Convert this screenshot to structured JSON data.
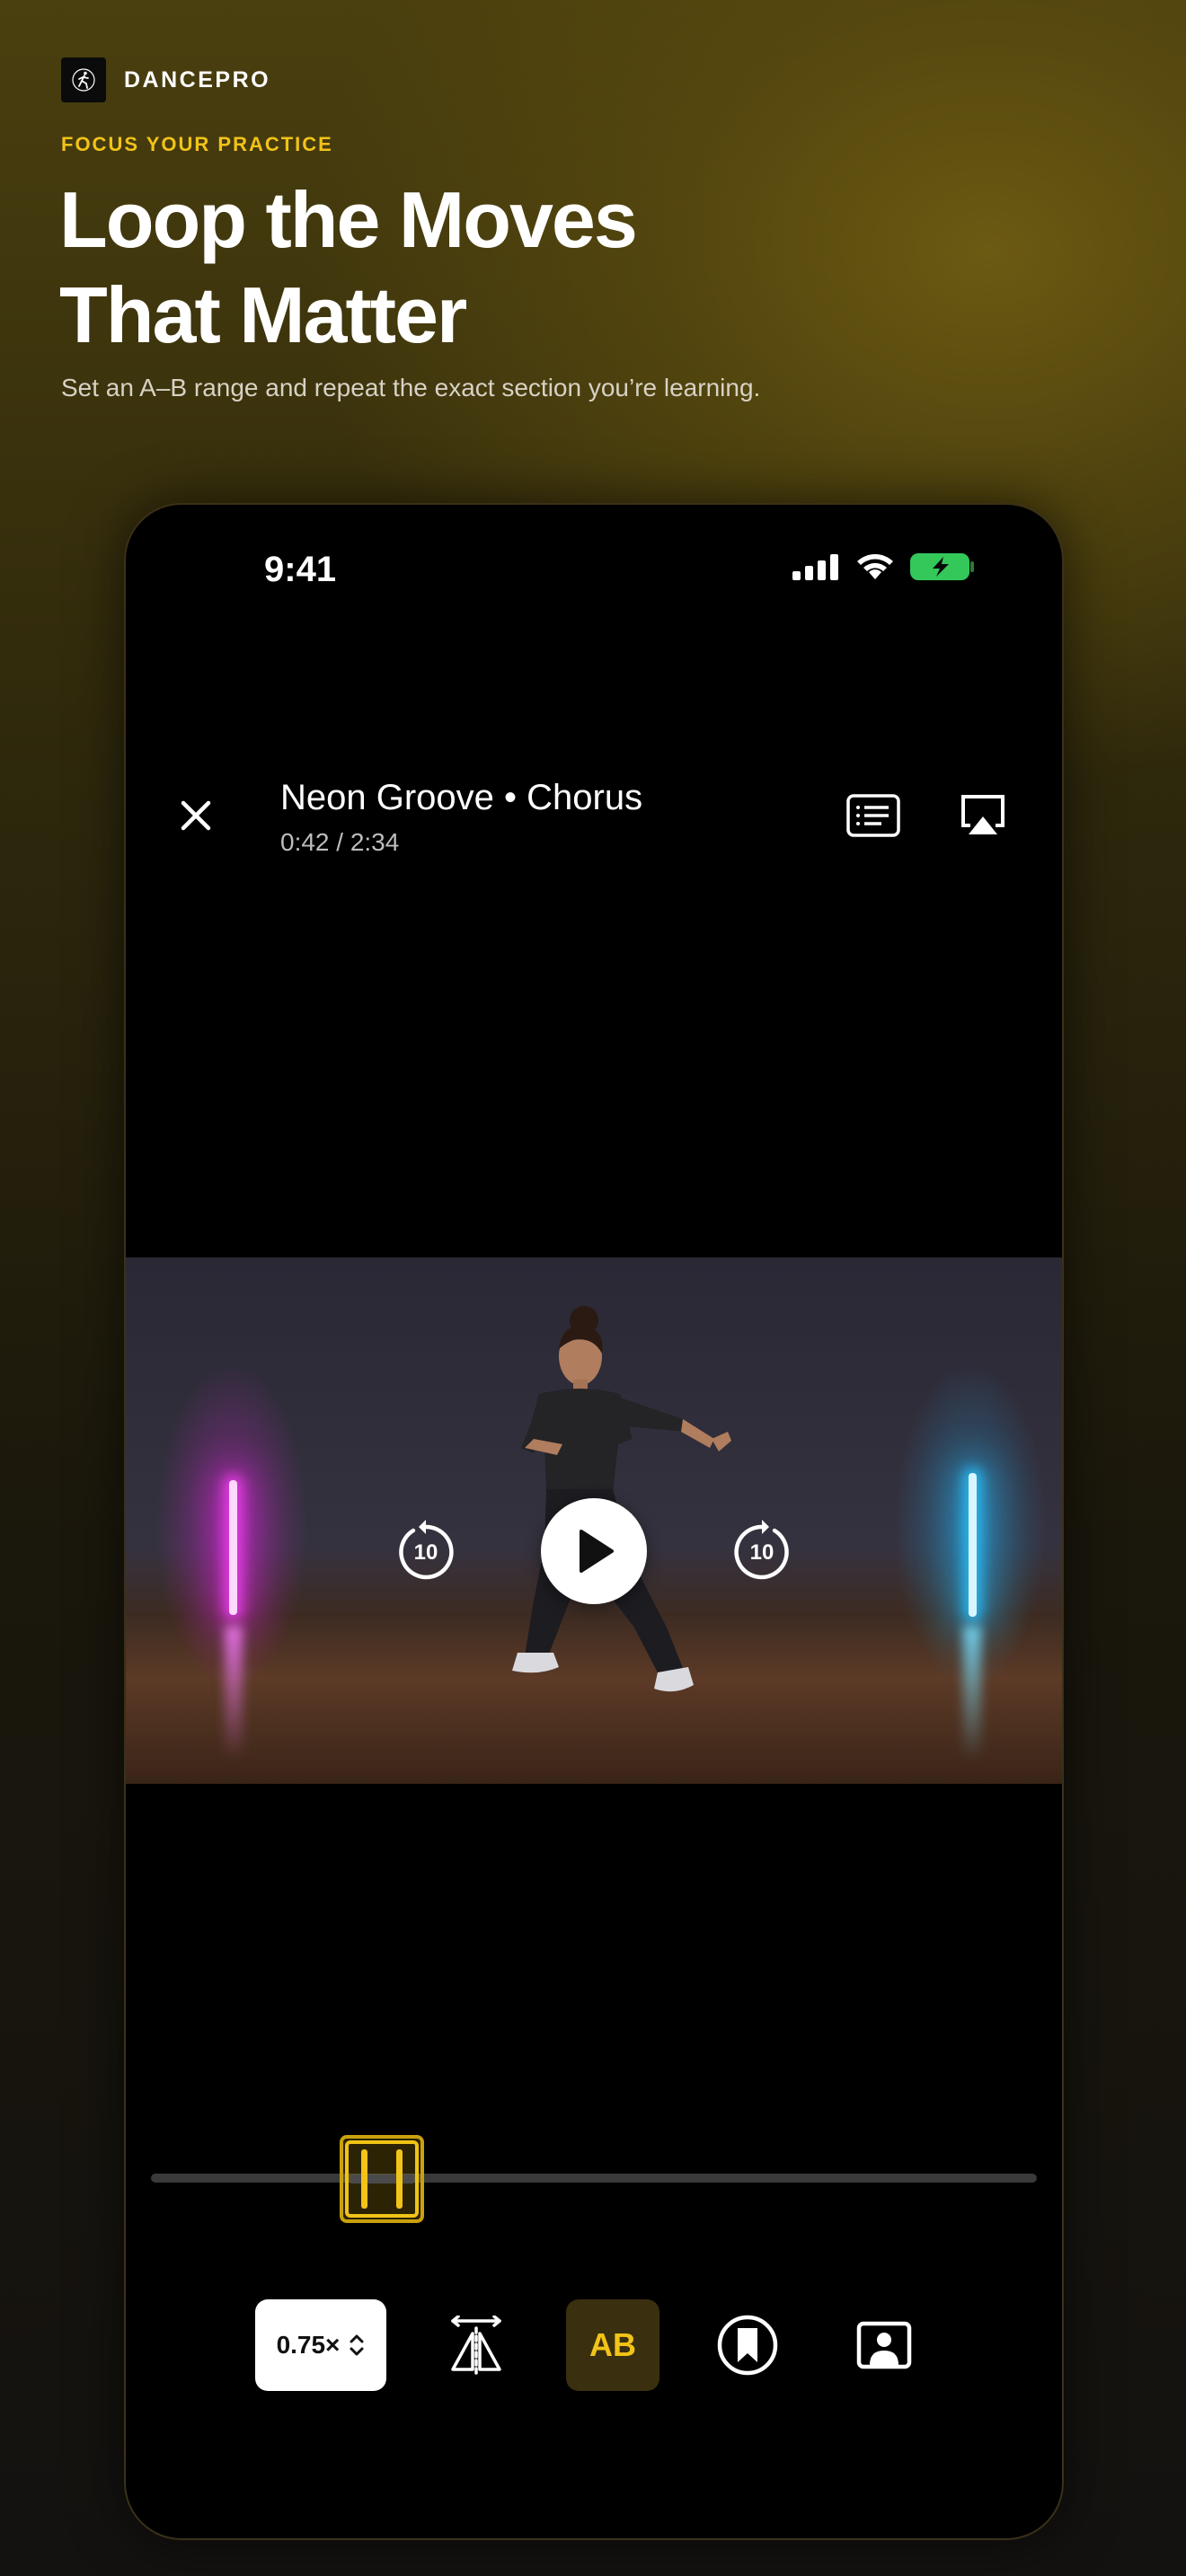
{
  "brand": {
    "name": "DANCEPRO"
  },
  "hero": {
    "eyebrow": "FOCUS YOUR PRACTICE",
    "headline_line1": "Loop the Moves",
    "headline_line2": "That Matter",
    "subhead": "Set an A–B range and repeat the exact section you’re learning."
  },
  "status_bar": {
    "time": "9:41",
    "icons": [
      "signal-icon",
      "wifi-icon",
      "battery-charging-icon"
    ]
  },
  "player": {
    "title": "Neon Groove • Chorus",
    "timecode": "0:42 / 2:34",
    "header_buttons": [
      "close-icon",
      "captions-icon",
      "airplay-icon"
    ],
    "skip_back_label": "10",
    "skip_forward_label": "10",
    "play_state": "paused",
    "loop_range_fraction": [
      0.21,
      0.29
    ]
  },
  "toolbar": {
    "speed_label": "0.75×",
    "ab_label": "AB",
    "tools": [
      "speed-picker",
      "mirror-icon",
      "ab-loop",
      "bookmark-icon",
      "portrait-icon"
    ]
  },
  "colors": {
    "accent": "#f2c318",
    "ab_bg": "#3a2f0e"
  }
}
